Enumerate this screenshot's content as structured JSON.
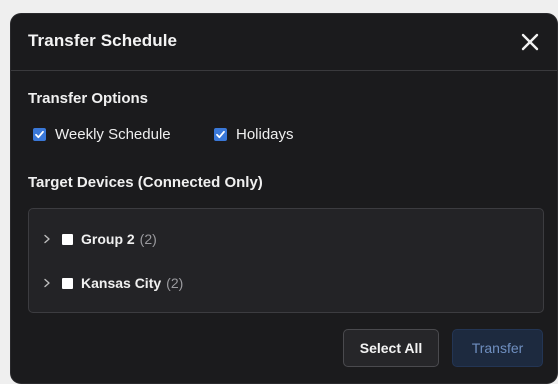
{
  "dialog": {
    "title": "Transfer Schedule",
    "close_icon": "close-icon"
  },
  "options": {
    "heading": "Transfer Options",
    "items": [
      {
        "label": "Weekly Schedule",
        "checked": true
      },
      {
        "label": "Holidays",
        "checked": true
      }
    ]
  },
  "devices": {
    "heading": "Target Devices (Connected Only)",
    "groups": [
      {
        "name": "Group 2",
        "count": "(2)",
        "checked": false,
        "expanded": false
      },
      {
        "name": "Kansas City",
        "count": "(2)",
        "checked": false,
        "expanded": false
      }
    ]
  },
  "actions": {
    "select_all_label": "Select All",
    "transfer_label": "Transfer",
    "transfer_enabled": false
  },
  "colors": {
    "dialog_bg": "#1b1b1d",
    "accent_checkbox": "#3a78d8",
    "transfer_disabled_text": "#6f8fc0"
  }
}
